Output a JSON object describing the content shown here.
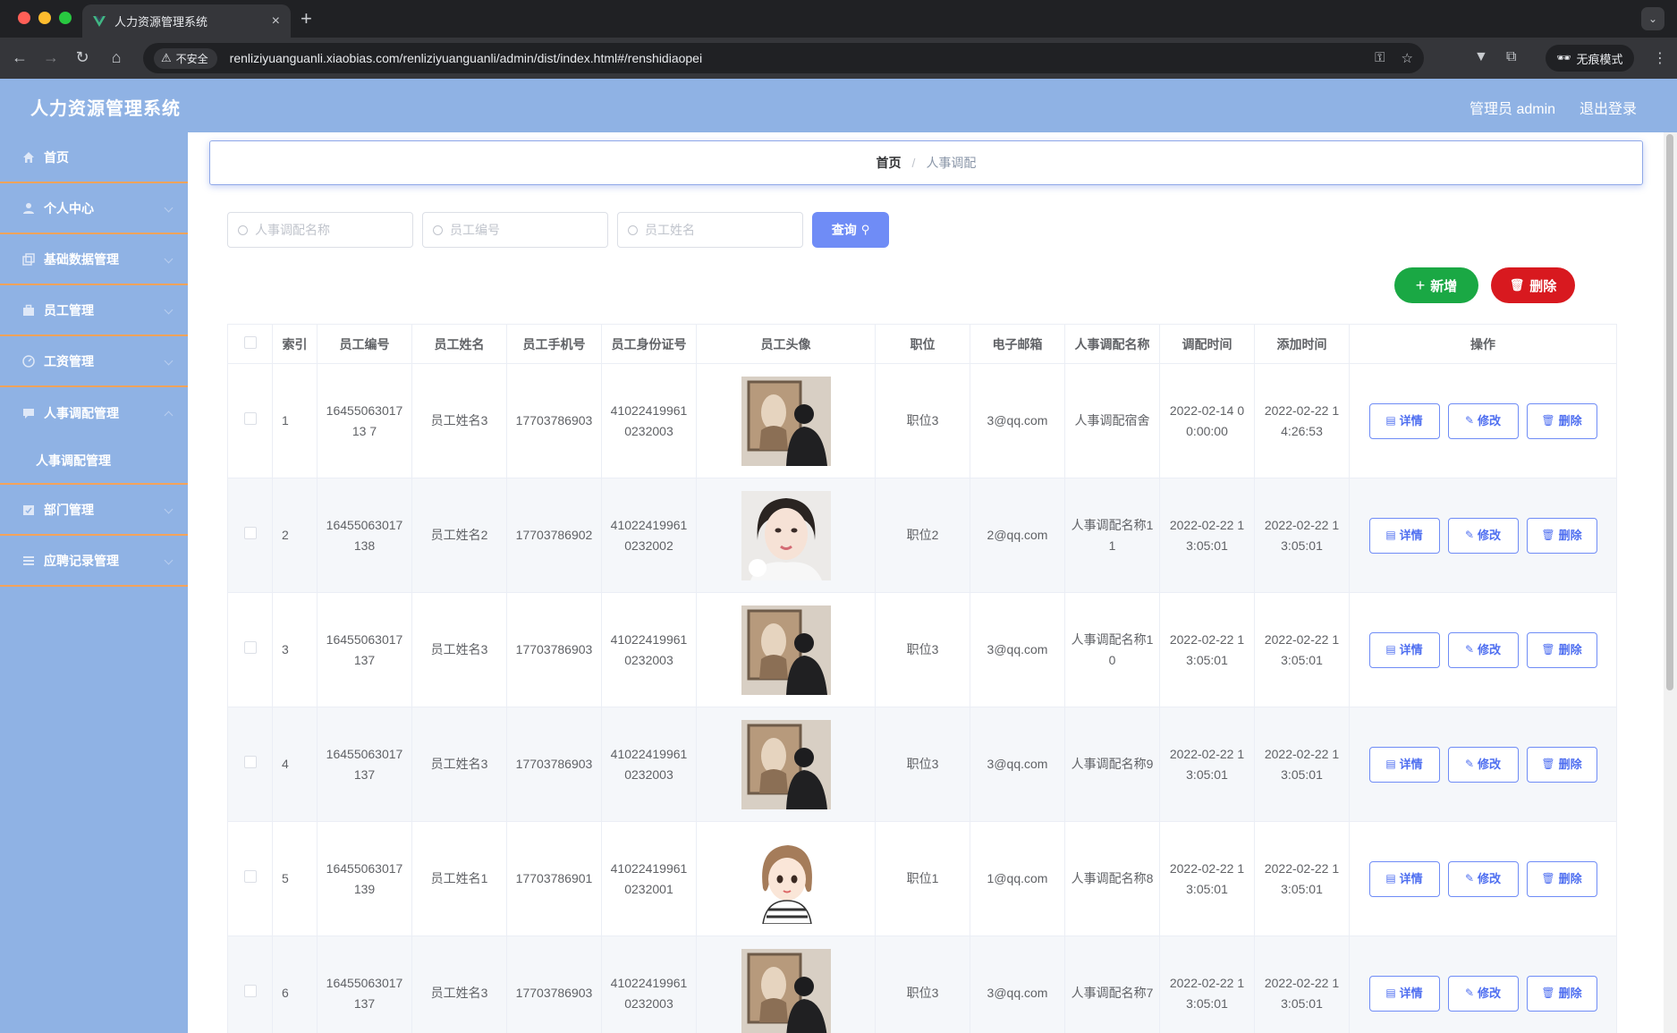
{
  "browser": {
    "tab_title": "人力资源管理系统",
    "security_label": "不安全",
    "url": "renliziyuanguanli.xiaobias.com/renliziyuanguanli/admin/dist/index.html#/renshidiaopei",
    "incognito_label": "无痕模式"
  },
  "header": {
    "app_title": "人力资源管理系统",
    "user_label": "管理员 admin",
    "logout_label": "退出登录"
  },
  "sidebar": {
    "items": [
      {
        "label": "首页",
        "icon": "home-icon"
      },
      {
        "label": "个人中心",
        "icon": "user-icon"
      },
      {
        "label": "基础数据管理",
        "icon": "copy-icon"
      },
      {
        "label": "员工管理",
        "icon": "briefcase-icon"
      },
      {
        "label": "工资管理",
        "icon": "gauge-icon"
      },
      {
        "label": "人事调配管理",
        "icon": "chat-icon"
      },
      {
        "label": "部门管理",
        "icon": "calendar-check-icon"
      },
      {
        "label": "应聘记录管理",
        "icon": "list-icon"
      }
    ],
    "subitem": "人事调配管理"
  },
  "breadcrumb": {
    "home": "首页",
    "separator": "/",
    "current": "人事调配"
  },
  "search": {
    "name_placeholder": "人事调配名称",
    "code_placeholder": "员工编号",
    "staff_placeholder": "员工姓名",
    "query_label": "查询"
  },
  "actions": {
    "add_label": "新增",
    "delete_label": "删除"
  },
  "table": {
    "columns": [
      "索引",
      "员工编号",
      "员工姓名",
      "员工手机号",
      "员工身份证号",
      "员工头像",
      "职位",
      "电子邮箱",
      "人事调配名称",
      "调配时间",
      "添加时间",
      "操作"
    ],
    "op_labels": {
      "detail": "详情",
      "edit": "修改",
      "delete": "删除"
    },
    "rows": [
      {
        "index": "1",
        "code": "1645506301713 7",
        "name": "员工姓名3",
        "phone": "17703786903",
        "id_card": "410224199610232003",
        "avatar": "photo-man",
        "position": "职位3",
        "email": "3@qq.com",
        "transfer": "人事调配宿舍",
        "transfer_time": "2022-02-14 00:00:00",
        "added": "2022-02-22 14:26:53"
      },
      {
        "index": "2",
        "code": "16455063017138",
        "name": "员工姓名2",
        "phone": "17703786902",
        "id_card": "410224199610232002",
        "avatar": "photo-woman",
        "position": "职位2",
        "email": "2@qq.com",
        "transfer": "人事调配名称11",
        "transfer_time": "2022-02-22 13:05:01",
        "added": "2022-02-22 13:05:01"
      },
      {
        "index": "3",
        "code": "16455063017137",
        "name": "员工姓名3",
        "phone": "17703786903",
        "id_card": "410224199610232003",
        "avatar": "photo-man",
        "position": "职位3",
        "email": "3@qq.com",
        "transfer": "人事调配名称10",
        "transfer_time": "2022-02-22 13:05:01",
        "added": "2022-02-22 13:05:01"
      },
      {
        "index": "4",
        "code": "16455063017137",
        "name": "员工姓名3",
        "phone": "17703786903",
        "id_card": "410224199610232003",
        "avatar": "photo-man",
        "position": "职位3",
        "email": "3@qq.com",
        "transfer": "人事调配名称9",
        "transfer_time": "2022-02-22 13:05:01",
        "added": "2022-02-22 13:05:01"
      },
      {
        "index": "5",
        "code": "16455063017139",
        "name": "员工姓名1",
        "phone": "17703786901",
        "id_card": "410224199610232001",
        "avatar": "cartoon-girl",
        "position": "职位1",
        "email": "1@qq.com",
        "transfer": "人事调配名称8",
        "transfer_time": "2022-02-22 13:05:01",
        "added": "2022-02-22 13:05:01"
      },
      {
        "index": "6",
        "code": "16455063017137",
        "name": "员工姓名3",
        "phone": "17703786903",
        "id_card": "410224199610232003",
        "avatar": "photo-man",
        "position": "职位3",
        "email": "3@qq.com",
        "transfer": "人事调配名称7",
        "transfer_time": "2022-02-22 13:05:01",
        "added": "2022-02-22 13:05:01"
      }
    ]
  },
  "colors": {
    "header_bg": "#8fb2e4",
    "sidebar_divider": "#f3a35b",
    "primary": "#6f8cf6",
    "success": "#1aa844",
    "danger": "#d8191f"
  }
}
